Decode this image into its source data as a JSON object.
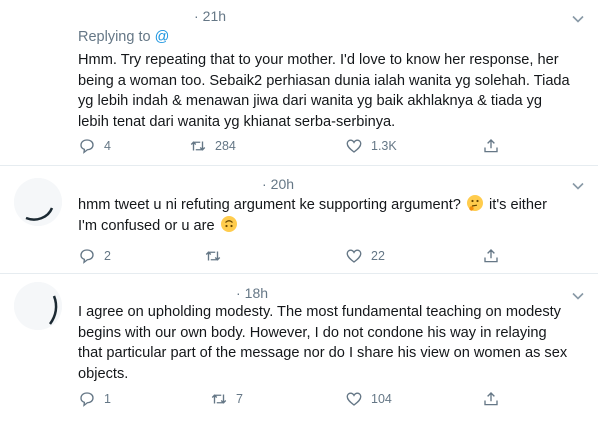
{
  "colors": {
    "text": "#14171a",
    "muted": "#657786",
    "divider": "#e6ecf0",
    "link": "#1b95e0",
    "emoji": "#ffcc4d"
  },
  "tweets": [
    {
      "time": "21h",
      "replying_label": "Replying to",
      "mention": "@",
      "lines": [
        "Hmm. Try repeating that to your mother. I'd love to know her response, her",
        "being a woman too. Sebaik2 perhiasan dunia ialah wanita yg solehah. Tiada",
        "yg lebih indah & menawan jiwa dari wanita yg baik akhlaknya & tiada yg",
        "lebih tenat dari wanita yg khianat serba-serbinya."
      ],
      "replies": "4",
      "retweets": "284",
      "likes": "1.3K"
    },
    {
      "time": "20h",
      "lines_html_parts": {
        "line1": "hmm tweet u ni refuting argument ke supporting argument?",
        "line1_tail": "it's either",
        "line2": "I'm confused or u are"
      },
      "replies": "2",
      "retweets": "",
      "likes": "22",
      "emoji": [
        "thinking-face",
        "upside-down-face"
      ]
    },
    {
      "time": "18h",
      "lines": [
        "I agree on upholding modesty. The most fundamental teaching on modesty",
        "begins with our own body. However, I do not condone his way in relaying",
        "that particular part of the message nor do I share his view on women as sex",
        "objects."
      ],
      "replies": "1",
      "retweets": "7",
      "likes": "104"
    }
  ],
  "icons": [
    "reply-icon",
    "retweet-icon",
    "like-icon",
    "share-icon",
    "chevron-down-icon"
  ]
}
